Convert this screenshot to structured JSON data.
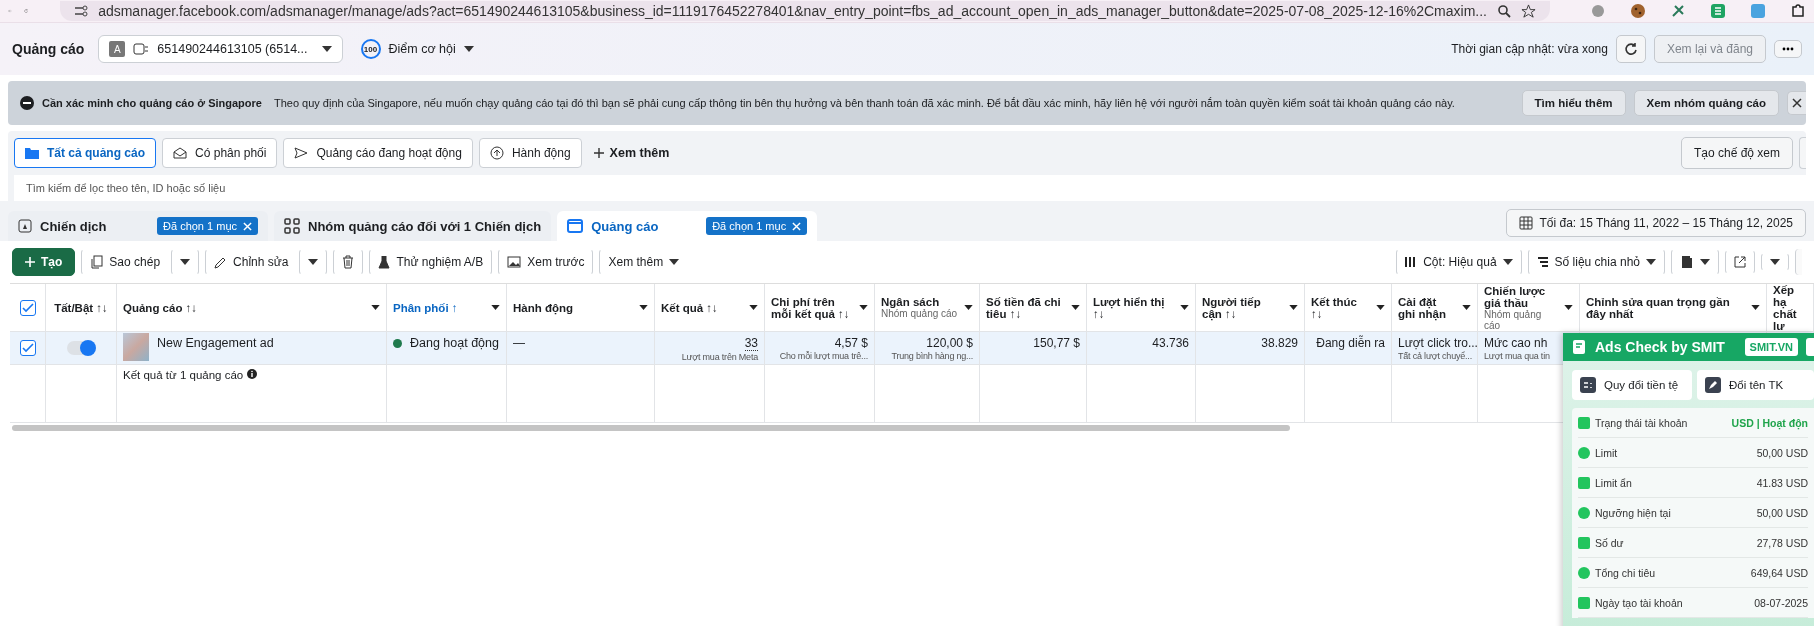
{
  "browser": {
    "url": "adsmanager.facebook.com/adsmanager/manage/ads?act=651490244613105&business_id=1119176452278401&nav_entry_point=fbs_ad_account_open_in_ads_manager_button&date=2025-07-08_2025-12-16%2Cmaxim..."
  },
  "header": {
    "title": "Quảng cáo",
    "account_avatar": "A",
    "account": "651490244613105 (6514...",
    "score": "100",
    "score_label": "Điểm cơ hội",
    "updated": "Thời gian cập nhật: vừa xong",
    "publish_button": "Xem lại và đăng"
  },
  "banner": {
    "title": "Cần xác minh cho quảng cáo ở Singapore",
    "text": "Theo quy định của Singapore, nếu muốn chạy quảng cáo tại đó thì bạn sẽ phải cung cấp thông tin bên thụ hưởng và bên thanh toán đã xác minh. Để bắt đầu xác minh, hãy liên hệ với người nắm toàn quyền kiểm soát tài khoản quảng cáo này.",
    "buttons": [
      "Tìm hiểu thêm",
      "Xem nhóm quảng cáo"
    ]
  },
  "filters": {
    "tabs": [
      {
        "label": "Tất cả quảng cáo",
        "selected": true
      },
      {
        "label": "Có phân phối",
        "selected": false
      },
      {
        "label": "Quảng cáo đang hoạt động",
        "selected": false
      },
      {
        "label": "Hành động",
        "selected": false
      }
    ],
    "more": "Xem thêm",
    "create_view": "Tạo chế độ xem"
  },
  "search": {
    "placeholder": "Tìm kiếm để lọc theo tên, ID hoặc số liệu"
  },
  "levels": {
    "tabs": [
      {
        "label": "Chiến dịch",
        "badge": "Đã chọn 1 mục",
        "selected": false
      },
      {
        "label": "Nhóm quảng cáo đối với 1 Chiến dịch",
        "selected": false
      },
      {
        "label": "Quảng cáo",
        "badge": "Đã chọn 1 mục",
        "selected": true
      }
    ],
    "date_range": "Tối đa: 15 Tháng 11, 2022 – 15 Tháng 12, 2025"
  },
  "toolbar": {
    "create": "Tạo",
    "duplicate": "Sao chép",
    "edit": "Chỉnh sửa",
    "ab_test": "Thử nghiệm A/B",
    "preview": "Xem trước",
    "more": "Xem thêm",
    "columns": "Cột: Hiệu quả",
    "breakdown": "Số liệu chia nhỏ"
  },
  "table": {
    "columns": [
      {
        "kind": "select",
        "checked": true
      },
      {
        "label": "Tất/Bật ↑↓",
        "sorted": false
      },
      {
        "label": "Quảng cáo ↑↓",
        "sorted": false
      },
      {
        "label": "Phân phối ↑",
        "sorted": true
      },
      {
        "label": "Hành động",
        "sorted": false
      },
      {
        "label": "Kết quả ↑↓",
        "sorted": false
      },
      {
        "label": "Chi phí trên mỗi kết quả ↑↓",
        "sorted": false
      },
      {
        "label": "Ngân sách",
        "sub": "Nhóm quảng cáo",
        "sorted": false
      },
      {
        "label": "Số tiền đã chi tiêu ↑↓",
        "sorted": false
      },
      {
        "label": "Lượt hiển thị ↑↓",
        "sorted": false
      },
      {
        "label": "Người tiếp cận ↑↓",
        "sorted": false
      },
      {
        "label": "Kết thúc ↑↓",
        "sorted": false
      },
      {
        "label": "Cài đặt ghi nhận",
        "sorted": false
      },
      {
        "label": "Chiến lược giá thầu",
        "sub": "Nhóm quảng cáo",
        "sorted": false
      },
      {
        "label": "Chỉnh sửa quan trọng gần đây nhất",
        "sorted": false
      },
      {
        "label": "Xếp hạ chất lư",
        "sorted": false
      }
    ],
    "rows": [
      {
        "cells": [
          {
            "kind": "checkbox",
            "checked": true
          },
          {
            "kind": "toggle",
            "on": true
          },
          {
            "kind": "ad",
            "value": "New Engagement ad"
          },
          {
            "kind": "status",
            "value": "Đang hoạt động",
            "color": "#1f7a4d"
          },
          {
            "value": "—"
          },
          {
            "value": "33",
            "sub": "Lượt mua trên Meta"
          },
          {
            "value": "4,57 $",
            "sub": "Cho mỗi lượt mua trê..."
          },
          {
            "value": "120,00 $",
            "sub": "Trung bình hàng ng..."
          },
          {
            "value": "150,77 $"
          },
          {
            "value": "43.736"
          },
          {
            "value": "38.829"
          },
          {
            "value": "Đang diễn ra"
          },
          {
            "value": "Lượt click tro...",
            "sub": "Tất cả lượt chuyể..."
          },
          {
            "value": "Mức cao nh",
            "sub": "Lượt mua qua tin"
          }
        ]
      }
    ],
    "summary": "Kết quả từ 1 quảng cáo"
  },
  "smit": {
    "title": "Ads Check by SMIT",
    "link": "SMIT.VN",
    "actions": [
      "Quy đổi tiền tệ",
      "Đổi tên TK"
    ],
    "rows": [
      {
        "label": "Trạng thái tài khoản",
        "value": "USD | Hoạt độn",
        "highlight": true
      },
      {
        "label": "Limit",
        "value": "50,00 USD",
        "highlight": false
      },
      {
        "label": "Limit ẩn",
        "value": "41.83 USD",
        "highlight": false
      },
      {
        "label": "Ngưỡng hiện tại",
        "value": "50,00 USD",
        "highlight": false
      },
      {
        "label": "Số dư",
        "value": "27,78 USD",
        "highlight": false
      },
      {
        "label": "Tổng chi tiêu",
        "value": "649,64 USD",
        "highlight": false
      },
      {
        "label": "Ngày tạo tài khoản",
        "value": "08-07-2025",
        "highlight": false
      }
    ]
  }
}
